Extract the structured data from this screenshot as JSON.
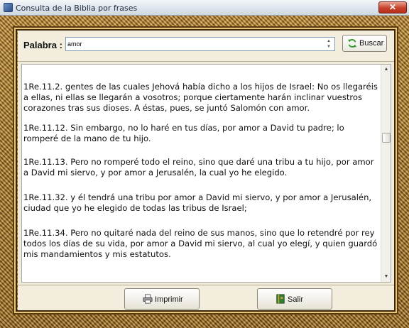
{
  "window": {
    "title": "Consulta de la Biblia por frases",
    "close_label": "✕"
  },
  "search": {
    "label": "Palabra :",
    "value": "amor",
    "button_label": "Buscar"
  },
  "results": [
    {
      "text": "1Re.11.2.  gentes de las cuales Jehová había dicho a los hijos de Israel: No os llegaréis a ellas, ni ellas se llegarán a vosotros; porque ciertamente harán inclinar vuestros corazones tras sus dioses. A éstas, pues, se juntó Salomón con amor."
    },
    {
      "text": "1Re.11.12.  Sin embargo, no lo haré en tus días, por amor a David tu padre; lo romperé de la mano de tu hijo."
    },
    {
      "text": "1Re.11.13.  Pero no romperé todo el reino, sino que daré una tribu a tu hijo, por amor a David mi siervo, y por amor a Jerusalén, la cual yo he elegido."
    },
    {
      "text": "1Re.11.32.  y él tendrá una tribu por amor a David mi siervo, y por amor a Jerusalén, ciudad que yo he elegido de todas las tribus de Israel;"
    },
    {
      "text": "1Re.11.34.  Pero no quitaré nada del reino de sus manos, sino que lo retendré por rey todos los días de su vida, por amor a David mi siervo, al cual yo elegí, y quien guardó mis mandamientos y mis estatutos."
    }
  ],
  "buttons": {
    "print_label": "Imprimir",
    "exit_label": "Salir"
  },
  "icons": {
    "search_button": "refresh-icon",
    "print_button": "printer-icon",
    "exit_button": "book-icon"
  },
  "colors": {
    "panel_bg": "#f1ebda",
    "frame": "#8a5f22",
    "close_button": "#c6412a"
  }
}
